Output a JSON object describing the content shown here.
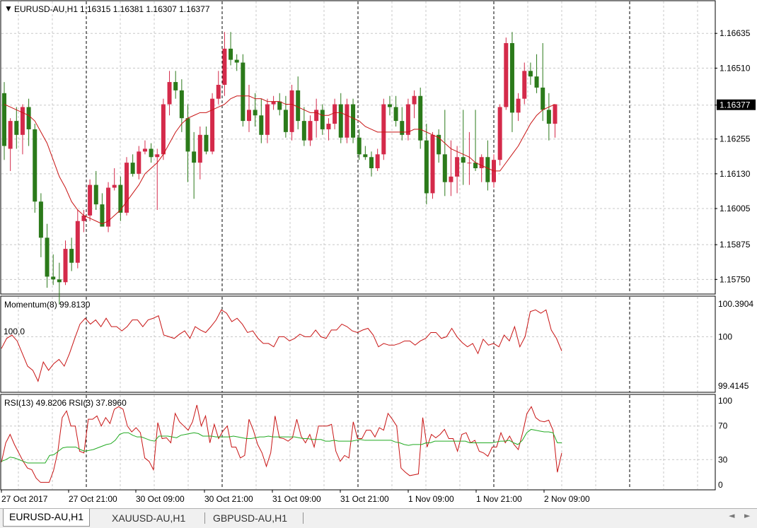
{
  "header": {
    "arrow": "▼",
    "symbol": "EURUSD-AU,H1",
    "ohlc": "1.16315 1.16381 1.16307 1.16377"
  },
  "colors": {
    "bull": "#2b7a1a",
    "bear": "#d42a4a",
    "ma": "#c81414",
    "momentum": "#c81414",
    "rsi13": "#c81414",
    "rsi3": "#22aa22",
    "grid": "#c8c8c8",
    "current_price_bg": "#000000"
  },
  "price_axis": {
    "ticks": [
      "1.16635",
      "1.16510",
      "1.16377",
      "1.16255",
      "1.16130",
      "1.16005",
      "1.15875",
      "1.15750"
    ],
    "current_price": "1.16377"
  },
  "momentum": {
    "title": "Momentum(8) 99.8130",
    "ref_label": "100,0",
    "ticks": [
      "100.3904",
      "100",
      "99.4145"
    ]
  },
  "rsi": {
    "title": "RSI(13) 49.8206  RSI(3) 37.8960",
    "ticks": [
      "100",
      "70",
      "30",
      "0"
    ]
  },
  "time_axis": [
    "27 Oct 2017",
    "27 Oct 21:00",
    "30 Oct 09:00",
    "30 Oct 21:00",
    "31 Oct 09:00",
    "31 Oct 21:00",
    "1 Nov 09:00",
    "1 Nov 21:00",
    "2 Nov 09:00"
  ],
  "tabs": [
    "EURUSD-AU,H1",
    "XAUUSD-AU,H1",
    "GBPUSD-AU,H1"
  ],
  "scroll": {
    "left": "◄",
    "right": "►"
  },
  "chart_data": [
    {
      "type": "candlestick",
      "title": "EURUSD-AU,H1",
      "price_range": [
        1.157,
        1.1675
      ],
      "x_labels": [
        "27 Oct 2017",
        "27 Oct 21:00",
        "30 Oct 09:00",
        "30 Oct 21:00",
        "31 Oct 09:00",
        "31 Oct 21:00",
        "1 Nov 09:00",
        "1 Nov 21:00",
        "2 Nov 09:00"
      ],
      "candles": [
        [
          1.1642,
          1.1646,
          1.1618,
          1.1623
        ],
        [
          1.1622,
          1.1633,
          1.1614,
          1.1632
        ],
        [
          1.1632,
          1.1637,
          1.1622,
          1.1627
        ],
        [
          1.1627,
          1.1638,
          1.162,
          1.1637
        ],
        [
          1.1637,
          1.164,
          1.1623,
          1.1629
        ],
        [
          1.1629,
          1.1631,
          1.1599,
          1.1603
        ],
        [
          1.1603,
          1.1606,
          1.1583,
          1.159
        ],
        [
          1.159,
          1.1595,
          1.1572,
          1.1576
        ],
        [
          1.1576,
          1.1584,
          1.1573,
          1.1575
        ],
        [
          1.1575,
          1.1581,
          1.1566,
          1.1574
        ],
        [
          1.1574,
          1.1589,
          1.1573,
          1.1586
        ],
        [
          1.1586,
          1.159,
          1.1578,
          1.1581
        ],
        [
          1.1581,
          1.16,
          1.1579,
          1.1596
        ],
        [
          1.1596,
          1.16,
          1.1592,
          1.1598
        ],
        [
          1.1598,
          1.1611,
          1.1596,
          1.1609
        ],
        [
          1.1609,
          1.1614,
          1.16,
          1.1602
        ],
        [
          1.1602,
          1.1606,
          1.1596,
          1.1594
        ],
        [
          1.1594,
          1.161,
          1.1592,
          1.1608
        ],
        [
          1.1608,
          1.1615,
          1.1607,
          1.1609
        ],
        [
          1.1609,
          1.1612,
          1.1596,
          1.1599
        ],
        [
          1.1599,
          1.1619,
          1.1598,
          1.1617
        ],
        [
          1.1617,
          1.162,
          1.1612,
          1.1613
        ],
        [
          1.1613,
          1.1623,
          1.1611,
          1.1621
        ],
        [
          1.1621,
          1.1625,
          1.162,
          1.1622
        ],
        [
          1.1622,
          1.1624,
          1.1617,
          1.1619
        ],
        [
          1.1619,
          1.1622,
          1.16,
          1.162
        ],
        [
          1.162,
          1.164,
          1.1618,
          1.1638
        ],
        [
          1.1638,
          1.165,
          1.1634,
          1.1646
        ],
        [
          1.1646,
          1.165,
          1.164,
          1.1643
        ],
        [
          1.1643,
          1.1647,
          1.1628,
          1.1633
        ],
        [
          1.1633,
          1.1638,
          1.161,
          1.1621
        ],
        [
          1.1621,
          1.1628,
          1.1604,
          1.1617
        ],
        [
          1.1617,
          1.163,
          1.1611,
          1.1627
        ],
        [
          1.1627,
          1.163,
          1.162,
          1.1621
        ],
        [
          1.1621,
          1.1642,
          1.162,
          1.164
        ],
        [
          1.164,
          1.165,
          1.1638,
          1.1645
        ],
        [
          1.1645,
          1.1664,
          1.1641,
          1.1658
        ],
        [
          1.1658,
          1.1664,
          1.1652,
          1.1654
        ],
        [
          1.1654,
          1.1656,
          1.165,
          1.1653
        ],
        [
          1.1653,
          1.1656,
          1.163,
          1.1632
        ],
        [
          1.1632,
          1.1645,
          1.1628,
          1.1636
        ],
        [
          1.1636,
          1.1642,
          1.163,
          1.1634
        ],
        [
          1.1634,
          1.164,
          1.1624,
          1.1627
        ],
        [
          1.1627,
          1.164,
          1.1624,
          1.1638
        ],
        [
          1.1638,
          1.1641,
          1.1636,
          1.1639
        ],
        [
          1.1639,
          1.1642,
          1.1634,
          1.1636
        ],
        [
          1.1636,
          1.1641,
          1.1626,
          1.1628
        ],
        [
          1.1628,
          1.1645,
          1.1625,
          1.1643
        ],
        [
          1.1643,
          1.1648,
          1.1629,
          1.1632
        ],
        [
          1.1632,
          1.1637,
          1.1623,
          1.1625
        ],
        [
          1.1625,
          1.1634,
          1.1623,
          1.1632
        ],
        [
          1.1632,
          1.164,
          1.1626,
          1.1636
        ],
        [
          1.1636,
          1.1638,
          1.1627,
          1.1629
        ],
        [
          1.1629,
          1.1633,
          1.1625,
          1.1631
        ],
        [
          1.1631,
          1.164,
          1.1629,
          1.1638
        ],
        [
          1.1638,
          1.1642,
          1.1624,
          1.1626
        ],
        [
          1.1626,
          1.164,
          1.1624,
          1.1638
        ],
        [
          1.1638,
          1.164,
          1.1624,
          1.1626
        ],
        [
          1.1626,
          1.1629,
          1.1618,
          1.162
        ],
        [
          1.162,
          1.1623,
          1.1618,
          1.1619
        ],
        [
          1.1619,
          1.1621,
          1.1612,
          1.1615
        ],
        [
          1.1615,
          1.1622,
          1.1614,
          1.162
        ],
        [
          1.162,
          1.164,
          1.1618,
          1.1638
        ],
        [
          1.1638,
          1.1641,
          1.1634,
          1.1637
        ],
        [
          1.1637,
          1.1641,
          1.163,
          1.1632
        ],
        [
          1.1632,
          1.1637,
          1.1625,
          1.1627
        ],
        [
          1.1627,
          1.164,
          1.1625,
          1.1638
        ],
        [
          1.1638,
          1.1643,
          1.1633,
          1.1641
        ],
        [
          1.1641,
          1.1644,
          1.1622,
          1.1625
        ],
        [
          1.1625,
          1.1631,
          1.1602,
          1.1606
        ],
        [
          1.1606,
          1.1628,
          1.1604,
          1.1627
        ],
        [
          1.1627,
          1.1629,
          1.1617,
          1.162
        ],
        [
          1.162,
          1.1636,
          1.1605,
          1.161
        ],
        [
          1.161,
          1.1625,
          1.1605,
          1.1612
        ],
        [
          1.1612,
          1.1623,
          1.1606,
          1.1619
        ],
        [
          1.1619,
          1.1636,
          1.1609,
          1.1617
        ],
        [
          1.1617,
          1.1628,
          1.1609,
          1.1617
        ],
        [
          1.1617,
          1.1636,
          1.1614,
          1.1615
        ],
        [
          1.1615,
          1.162,
          1.161,
          1.1619
        ],
        [
          1.1619,
          1.1625,
          1.1607,
          1.161
        ],
        [
          1.161,
          1.162,
          1.1608,
          1.1618
        ],
        [
          1.1618,
          1.1638,
          1.1616,
          1.1637
        ],
        [
          1.1637,
          1.1662,
          1.1636,
          1.166
        ],
        [
          1.166,
          1.1664,
          1.1628,
          1.1635
        ],
        [
          1.1635,
          1.1642,
          1.1632,
          1.164
        ],
        [
          1.164,
          1.1653,
          1.1638,
          1.165
        ],
        [
          1.165,
          1.1653,
          1.1645,
          1.1648
        ],
        [
          1.1648,
          1.1656,
          1.1642,
          1.1644
        ],
        [
          1.1644,
          1.166,
          1.1632,
          1.1636
        ],
        [
          1.1636,
          1.1642,
          1.1625,
          1.1631
        ],
        [
          1.1631,
          1.1638,
          1.1626,
          1.1638
        ]
      ],
      "ma_line": [
        1.1638,
        1.1637,
        1.1636,
        1.1635,
        1.1634,
        1.1632,
        1.1628,
        1.1624,
        1.1618,
        1.1612,
        1.1608,
        1.1603,
        1.16,
        1.1598,
        1.1597,
        1.1596,
        1.1595,
        1.1596,
        1.1598,
        1.16,
        1.1603,
        1.1606,
        1.1609,
        1.1613,
        1.1615,
        1.1617,
        1.162,
        1.1624,
        1.1628,
        1.1631,
        1.1633,
        1.1634,
        1.1635,
        1.1635,
        1.1636,
        1.1637,
        1.1638,
        1.164,
        1.1641,
        1.1641,
        1.1641,
        1.164,
        1.164,
        1.1639,
        1.1639,
        1.1639,
        1.1638,
        1.1638,
        1.1637,
        1.1636,
        1.1635,
        1.1635,
        1.1634,
        1.1634,
        1.1635,
        1.1635,
        1.1634,
        1.1633,
        1.1632,
        1.163,
        1.1629,
        1.1628,
        1.1628,
        1.1628,
        1.1628,
        1.1628,
        1.1628,
        1.1629,
        1.1629,
        1.1628,
        1.1627,
        1.1626,
        1.1624,
        1.1622,
        1.1621,
        1.162,
        1.1619,
        1.1617,
        1.1616,
        1.1615,
        1.1614,
        1.1614,
        1.1617,
        1.162,
        1.1623,
        1.1627,
        1.1631,
        1.1634,
        1.1636,
        1.1637,
        1.1638
      ]
    },
    {
      "type": "line",
      "title": "Momentum(8) 99.8130",
      "ylim": [
        99.4145,
        100.3904
      ],
      "values": [
        99.86,
        99.98,
        100.02,
        99.95,
        99.8,
        99.65,
        99.6,
        99.47,
        99.7,
        99.6,
        99.68,
        99.73,
        99.65,
        99.8,
        99.98,
        100.15,
        100.22,
        100.15,
        100.2,
        100.12,
        100.22,
        100.12,
        100.12,
        100.07,
        100.12,
        100.2,
        100.2,
        100.12,
        100.2,
        100.22,
        100.25,
        100.02,
        100.0,
        99.98,
        100.03,
        100.07,
        99.98,
        100.12,
        100.08,
        100.05,
        100.12,
        100.2,
        100.32,
        100.28,
        100.18,
        100.22,
        100.15,
        100.05,
        100.07,
        99.98,
        99.92,
        99.92,
        99.88,
        100.0,
        100.0,
        99.95,
        99.98,
        100.03,
        100.0,
        100.0,
        100.08,
        100.0,
        99.98,
        100.08,
        100.08,
        100.15,
        100.12,
        100.07,
        100.05,
        100.08,
        100.1,
        100.02,
        99.88,
        99.92,
        99.9,
        99.9,
        99.92,
        99.95,
        99.95,
        99.9,
        99.95,
        99.98,
        100.05,
        100.05,
        99.98,
        100.0,
        100.1,
        100.0,
        99.93,
        99.88,
        99.92,
        99.8,
        99.97,
        99.9,
        99.92,
        99.88,
        100.02,
        99.95,
        100.12,
        99.88,
        100.0,
        100.3,
        100.32,
        100.28,
        100.32,
        100.08,
        99.98,
        99.83
      ]
    },
    {
      "type": "line",
      "title": "RSI(13) 49.8206  RSI(3) 37.8960",
      "ylim": [
        0,
        100
      ],
      "series": [
        {
          "name": "RSI(13)",
          "values": [
            27,
            50,
            60,
            48,
            38,
            28,
            20,
            18,
            8,
            3,
            3,
            3,
            17,
            40,
            80,
            88,
            70,
            70,
            40,
            38,
            78,
            78,
            82,
            70,
            80,
            73,
            90,
            93,
            90,
            70,
            63,
            68,
            62,
            32,
            28,
            18,
            74,
            55,
            56,
            50,
            85,
            75,
            70,
            65,
            75,
            95,
            70,
            82,
            50,
            72,
            55,
            64,
            70,
            45,
            45,
            32,
            35,
            78,
            65,
            48,
            38,
            22,
            38,
            82,
            56,
            55,
            52,
            56,
            78,
            58,
            50,
            60,
            45,
            70,
            70,
            70,
            72,
            40,
            28,
            35,
            32,
            75,
            55,
            55,
            65,
            65,
            57,
            68,
            65,
            85,
            78,
            70,
            20,
            15,
            11,
            12,
            13,
            80,
            45,
            60,
            56,
            60,
            66,
            55,
            55,
            40,
            60,
            62,
            50,
            53,
            40,
            38,
            34,
            45,
            45,
            62,
            50,
            58,
            48,
            42,
            62,
            85,
            93,
            80,
            76,
            75,
            77,
            65,
            15,
            38
          ]
        },
        {
          "name": "RSI(3)",
          "values": [
            28,
            30,
            33,
            32,
            30,
            28,
            26,
            26,
            26,
            26,
            26,
            35,
            36,
            40,
            44,
            45,
            45,
            45,
            42,
            40,
            41,
            42,
            44,
            46,
            48,
            49,
            53,
            60,
            62,
            62,
            59,
            57,
            57,
            55,
            53,
            52,
            58,
            58,
            58,
            57,
            56,
            59,
            60,
            61,
            62,
            61,
            58,
            58,
            58,
            57,
            57,
            57,
            57,
            58,
            57,
            56,
            55,
            55,
            56,
            57,
            57,
            58,
            57,
            57,
            57,
            57,
            57,
            57,
            56,
            55,
            55,
            54,
            54,
            54,
            52,
            52,
            53,
            52,
            52,
            52,
            52,
            53,
            54,
            53,
            53,
            53,
            53,
            53,
            53,
            53,
            51,
            50,
            48,
            47,
            48,
            48,
            48,
            50,
            50,
            52,
            52,
            52,
            52,
            52,
            52,
            52,
            52,
            50,
            50,
            50,
            50,
            50,
            50,
            51,
            52,
            52,
            53,
            50,
            48,
            53,
            62,
            66,
            65,
            64,
            63,
            63,
            62,
            50,
            50
          ]
        }
      ]
    }
  ]
}
